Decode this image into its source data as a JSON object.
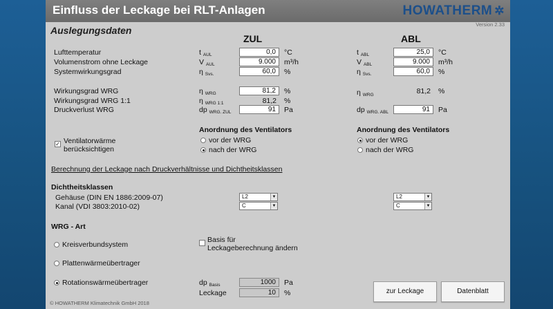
{
  "colors": {
    "background": "#1d5f96",
    "window": "#cdcdcd",
    "titlebar": "#6b6b6b",
    "brand": "#1c4f8a"
  },
  "window": {
    "title": "Einfluss der Leckage bei RLT-Anlagen",
    "logo": "HOWATHERM",
    "version": "Version 2.33"
  },
  "section_title": "Auslegungsdaten",
  "columns": {
    "zul": "ZUL",
    "abl": "ABL"
  },
  "labels": {
    "lufttemperatur": "Lufttemperatur",
    "volumenstrom": "Volumenstrom ohne Leckage",
    "systemwirkungsgrad": "Systemwirkungsgrad",
    "wirkungsgrad_wrg": "Wirkungsgrad WRG",
    "wirkungsgrad_wrg11": "Wirkungsgrad WRG 1:1",
    "druckverlust_wrg": "Druckverlust WRG"
  },
  "units": {
    "celsius": "°C",
    "volume": "m³/h",
    "percent": "%",
    "pascal": "Pa"
  },
  "zul": {
    "t_sym": "t",
    "t_sub": "AUL",
    "t_value": "0,0",
    "v_sym": "V",
    "v_sub": "AUL",
    "v_value": "9.000",
    "eta_sym": "η",
    "eta_sub": "Svs.",
    "eta_value": "60,0",
    "wrg_sym": "η",
    "wrg_sub": "WRG",
    "wrg_value": "81,2",
    "wrg11_sym": "η",
    "wrg11_sub": "WRG 1:1",
    "wrg11_value": "81,2",
    "dp_sym": "dp",
    "dp_sub": "WRG. ZUL",
    "dp_value": "91"
  },
  "abl": {
    "t_sym": "t",
    "t_sub": "ABL",
    "t_value": "25,0",
    "v_sym": "V",
    "v_sub": "ABL",
    "v_value": "9.000",
    "eta_sym": "η",
    "eta_sub": "Svs.",
    "eta_value": "60,0",
    "wrg_sym": "η",
    "wrg_sub": "WRG",
    "wrg_value": "81,2",
    "dp_sym": "dp",
    "dp_sub": "WRG. ABL",
    "dp_value": "91"
  },
  "ventilatorwaerme": {
    "checked": true,
    "line1": "Ventilatorwärme",
    "line2": "berücksichtigen",
    "mark": "✓"
  },
  "anordnung": {
    "title": "Anordnung des Ventilators",
    "option_before": "vor der WRG",
    "option_after": "nach der WRG",
    "zul_selected": "nach der WRG",
    "abl_selected": "vor der WRG"
  },
  "berechnung_link": "Berechnung der Leckage nach  Druckverhältnisse und Dichtheitsklassen",
  "dichtheitsklassen": {
    "title": "Dichtheitsklassen",
    "gehaeuse_label": "Gehäuse (DIN EN 1886:2009-07)",
    "kanal_label": "Kanal (VDI 3803:2010-02)",
    "zul_gehaeuse": "L2",
    "zul_kanal": "C",
    "abl_gehaeuse": "L2",
    "abl_kanal": "C",
    "arrow": "▼"
  },
  "wrg_art": {
    "title": "WRG - Art",
    "kreisverbund": "Kreisverbundsystem",
    "platten": "Plattenwärmeübertrager",
    "rotation": "Rotationswärmeübertrager",
    "selected": "Rotationswärmeübertrager"
  },
  "basis": {
    "checked": false,
    "line1": "Basis für",
    "line2": "Leckageberechnung ändern"
  },
  "dp_basis": {
    "sym": "dp",
    "sub": "Basis",
    "value": "1000",
    "unit": "Pa"
  },
  "leckage": {
    "label": "Leckage",
    "value": "10",
    "unit": "%"
  },
  "buttons": {
    "zur_leckage": "zur Leckage",
    "datenblatt": "Datenblatt"
  },
  "footer": "© HOWATHERM Klimatechnik GmbH 2018"
}
